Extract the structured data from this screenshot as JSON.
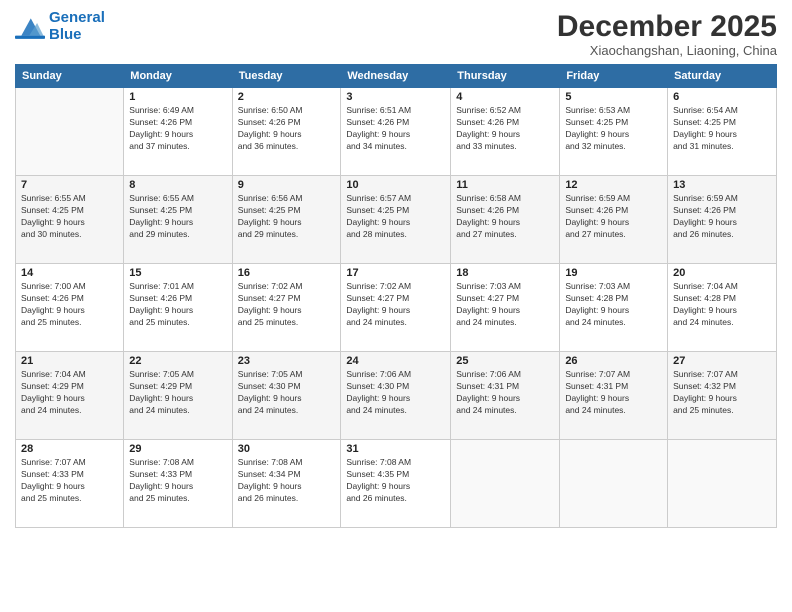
{
  "header": {
    "logo_line1": "General",
    "logo_line2": "Blue",
    "month": "December 2025",
    "location": "Xiaochangshan, Liaoning, China"
  },
  "days_of_week": [
    "Sunday",
    "Monday",
    "Tuesday",
    "Wednesday",
    "Thursday",
    "Friday",
    "Saturday"
  ],
  "weeks": [
    [
      {
        "day": "",
        "info": ""
      },
      {
        "day": "1",
        "info": "Sunrise: 6:49 AM\nSunset: 4:26 PM\nDaylight: 9 hours\nand 37 minutes."
      },
      {
        "day": "2",
        "info": "Sunrise: 6:50 AM\nSunset: 4:26 PM\nDaylight: 9 hours\nand 36 minutes."
      },
      {
        "day": "3",
        "info": "Sunrise: 6:51 AM\nSunset: 4:26 PM\nDaylight: 9 hours\nand 34 minutes."
      },
      {
        "day": "4",
        "info": "Sunrise: 6:52 AM\nSunset: 4:26 PM\nDaylight: 9 hours\nand 33 minutes."
      },
      {
        "day": "5",
        "info": "Sunrise: 6:53 AM\nSunset: 4:25 PM\nDaylight: 9 hours\nand 32 minutes."
      },
      {
        "day": "6",
        "info": "Sunrise: 6:54 AM\nSunset: 4:25 PM\nDaylight: 9 hours\nand 31 minutes."
      }
    ],
    [
      {
        "day": "7",
        "info": "Sunrise: 6:55 AM\nSunset: 4:25 PM\nDaylight: 9 hours\nand 30 minutes."
      },
      {
        "day": "8",
        "info": "Sunrise: 6:55 AM\nSunset: 4:25 PM\nDaylight: 9 hours\nand 29 minutes."
      },
      {
        "day": "9",
        "info": "Sunrise: 6:56 AM\nSunset: 4:25 PM\nDaylight: 9 hours\nand 29 minutes."
      },
      {
        "day": "10",
        "info": "Sunrise: 6:57 AM\nSunset: 4:25 PM\nDaylight: 9 hours\nand 28 minutes."
      },
      {
        "day": "11",
        "info": "Sunrise: 6:58 AM\nSunset: 4:26 PM\nDaylight: 9 hours\nand 27 minutes."
      },
      {
        "day": "12",
        "info": "Sunrise: 6:59 AM\nSunset: 4:26 PM\nDaylight: 9 hours\nand 27 minutes."
      },
      {
        "day": "13",
        "info": "Sunrise: 6:59 AM\nSunset: 4:26 PM\nDaylight: 9 hours\nand 26 minutes."
      }
    ],
    [
      {
        "day": "14",
        "info": "Sunrise: 7:00 AM\nSunset: 4:26 PM\nDaylight: 9 hours\nand 25 minutes."
      },
      {
        "day": "15",
        "info": "Sunrise: 7:01 AM\nSunset: 4:26 PM\nDaylight: 9 hours\nand 25 minutes."
      },
      {
        "day": "16",
        "info": "Sunrise: 7:02 AM\nSunset: 4:27 PM\nDaylight: 9 hours\nand 25 minutes."
      },
      {
        "day": "17",
        "info": "Sunrise: 7:02 AM\nSunset: 4:27 PM\nDaylight: 9 hours\nand 24 minutes."
      },
      {
        "day": "18",
        "info": "Sunrise: 7:03 AM\nSunset: 4:27 PM\nDaylight: 9 hours\nand 24 minutes."
      },
      {
        "day": "19",
        "info": "Sunrise: 7:03 AM\nSunset: 4:28 PM\nDaylight: 9 hours\nand 24 minutes."
      },
      {
        "day": "20",
        "info": "Sunrise: 7:04 AM\nSunset: 4:28 PM\nDaylight: 9 hours\nand 24 minutes."
      }
    ],
    [
      {
        "day": "21",
        "info": "Sunrise: 7:04 AM\nSunset: 4:29 PM\nDaylight: 9 hours\nand 24 minutes."
      },
      {
        "day": "22",
        "info": "Sunrise: 7:05 AM\nSunset: 4:29 PM\nDaylight: 9 hours\nand 24 minutes."
      },
      {
        "day": "23",
        "info": "Sunrise: 7:05 AM\nSunset: 4:30 PM\nDaylight: 9 hours\nand 24 minutes."
      },
      {
        "day": "24",
        "info": "Sunrise: 7:06 AM\nSunset: 4:30 PM\nDaylight: 9 hours\nand 24 minutes."
      },
      {
        "day": "25",
        "info": "Sunrise: 7:06 AM\nSunset: 4:31 PM\nDaylight: 9 hours\nand 24 minutes."
      },
      {
        "day": "26",
        "info": "Sunrise: 7:07 AM\nSunset: 4:31 PM\nDaylight: 9 hours\nand 24 minutes."
      },
      {
        "day": "27",
        "info": "Sunrise: 7:07 AM\nSunset: 4:32 PM\nDaylight: 9 hours\nand 25 minutes."
      }
    ],
    [
      {
        "day": "28",
        "info": "Sunrise: 7:07 AM\nSunset: 4:33 PM\nDaylight: 9 hours\nand 25 minutes."
      },
      {
        "day": "29",
        "info": "Sunrise: 7:08 AM\nSunset: 4:33 PM\nDaylight: 9 hours\nand 25 minutes."
      },
      {
        "day": "30",
        "info": "Sunrise: 7:08 AM\nSunset: 4:34 PM\nDaylight: 9 hours\nand 26 minutes."
      },
      {
        "day": "31",
        "info": "Sunrise: 7:08 AM\nSunset: 4:35 PM\nDaylight: 9 hours\nand 26 minutes."
      },
      {
        "day": "",
        "info": ""
      },
      {
        "day": "",
        "info": ""
      },
      {
        "day": "",
        "info": ""
      }
    ]
  ]
}
